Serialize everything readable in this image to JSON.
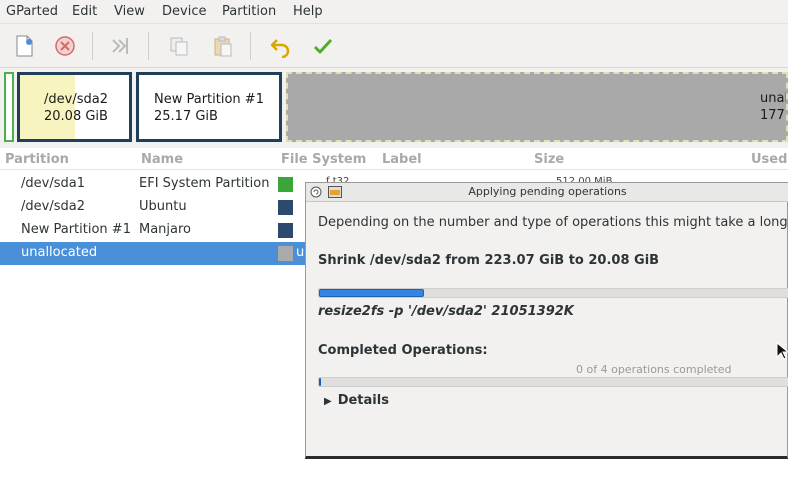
{
  "menu": [
    "GParted",
    "Edit",
    "View",
    "Device",
    "Partition",
    "Help"
  ],
  "toolbar": {
    "icons": [
      "new-icon",
      "delete-icon",
      "resize-move-icon",
      "copy-icon",
      "paste-icon",
      "undo-icon",
      "apply-icon"
    ]
  },
  "map": {
    "partitions": [
      {
        "name": "/dev/sda2",
        "size": "20.08 GiB",
        "used_fraction": 0.5
      },
      {
        "name": "New Partition #1",
        "size": "25.17 GiB"
      },
      {
        "name": "unal",
        "size": "177."
      }
    ]
  },
  "table": {
    "headers": [
      "Partition",
      "Name",
      "File System",
      "Label",
      "Size",
      "Used"
    ],
    "rows": [
      {
        "partition": "/dev/sda1",
        "name": "EFI System Partition",
        "color": "#3aa63a"
      },
      {
        "partition": "/dev/sda2",
        "name": "Ubuntu",
        "color": "#2c4a6e"
      },
      {
        "partition": "New Partition #1",
        "name": "Manjaro",
        "color": "#2c4a6e"
      },
      {
        "partition": "unallocated",
        "name": "",
        "fs_fragment": "u",
        "color": "#aaaaaa",
        "selected": true
      }
    ],
    "partial_cells": {
      "label_fragment": "f  t32",
      "size_fragment": "512.00 MiB"
    }
  },
  "dialog": {
    "title": "Applying pending operations",
    "description": "Depending on the number and type of operations this might take a long",
    "current_op": "Shrink /dev/sda2 from 223.07 GiB to 20.08 GiB",
    "command": "resize2fs -p '/dev/sda2' 21051392K",
    "progress_fraction": 0.22,
    "completed_label": "Completed Operations:",
    "completed_status": "0 of 4 operations completed",
    "completed_fraction": 0,
    "details_label": "Details"
  },
  "colors": {
    "selection": "#4a90d9",
    "selected_partition": "#1f3f5a",
    "unallocated": "#a9a9aa",
    "progress": "#3584e4"
  }
}
